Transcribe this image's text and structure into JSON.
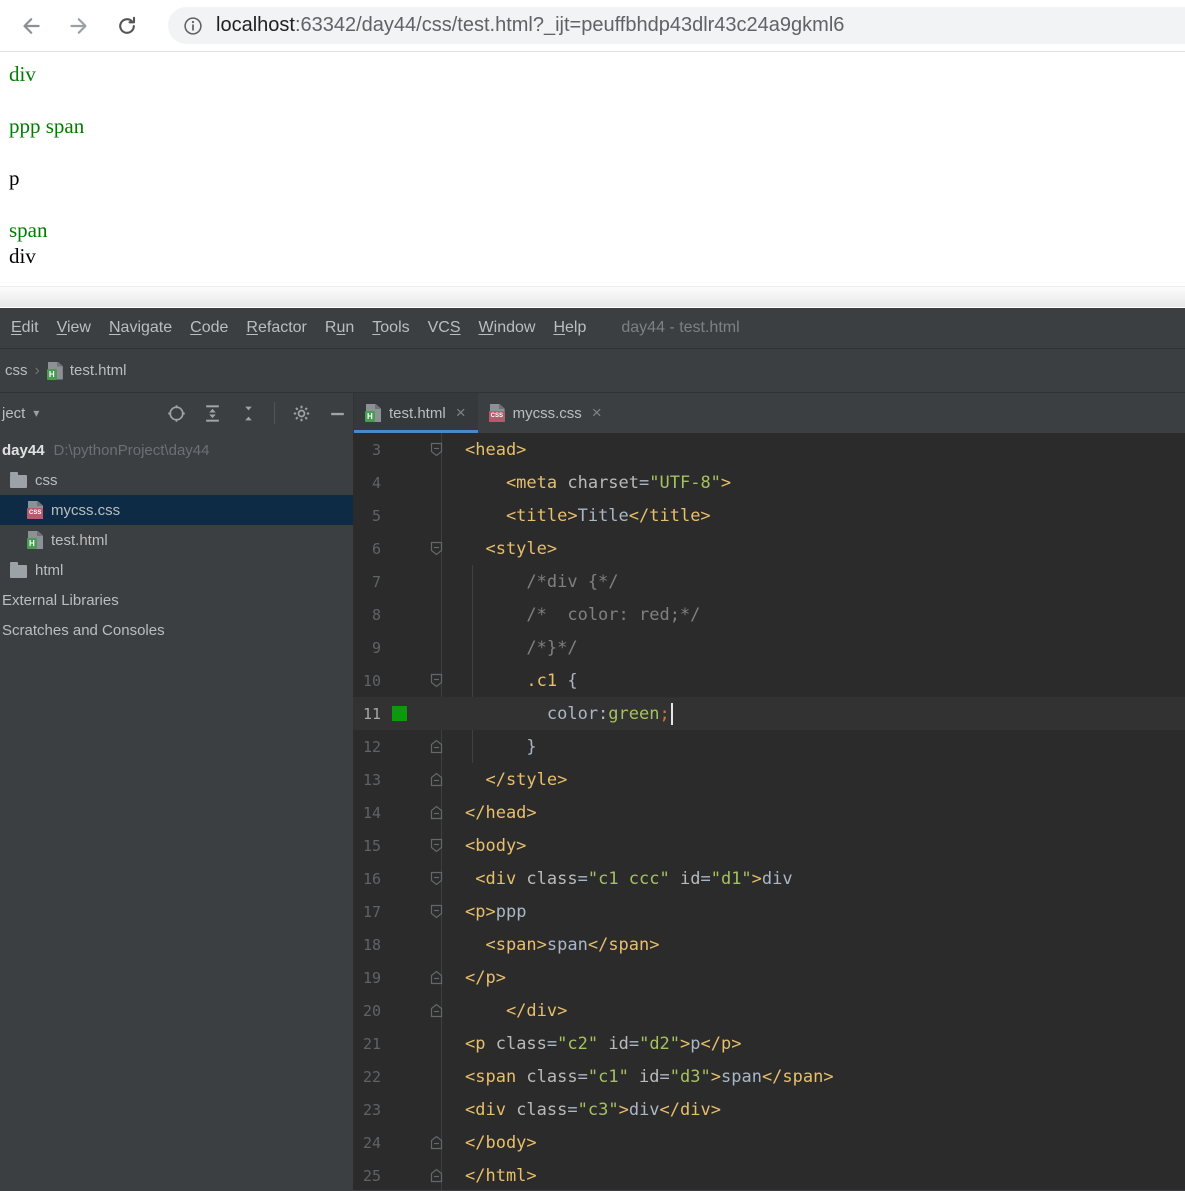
{
  "colors": {
    "content_green": "#007D00",
    "tab_accent_blue": "#4A88C7",
    "gutter_color_preview_green": "#0A9A0A",
    "editor_bg": "#2B2B2B",
    "panel_bg": "#3C3F41",
    "tree_selection_bg": "#0D2B45"
  },
  "browser": {
    "nav_icons": [
      "back-icon",
      "forward-icon",
      "reload-icon"
    ],
    "url": {
      "info_icon": "info-icon",
      "host": "localhost",
      "rest": ":63342/day44/css/test.html?_ijt=peuffbhdp43dlr43c24a9gkml6"
    },
    "content_lines": [
      {
        "text": "div",
        "color": "green",
        "gap_before": false
      },
      {
        "text": "ppp span",
        "color": "green",
        "gap_before": true
      },
      {
        "text": "p",
        "color": "black",
        "gap_before": true
      },
      {
        "text": "span",
        "color": "green",
        "gap_before": true
      },
      {
        "text": "div",
        "color": "black",
        "gap_before": false
      }
    ]
  },
  "menu": {
    "items": [
      {
        "label": "Edit",
        "m": 0
      },
      {
        "label": "View",
        "m": 0
      },
      {
        "label": "Navigate",
        "m": 0
      },
      {
        "label": "Code",
        "m": 0
      },
      {
        "label": "Refactor",
        "m": 0
      },
      {
        "label": "Run",
        "m": 1
      },
      {
        "label": "Tools",
        "m": 0
      },
      {
        "label": "VCS",
        "m": 2
      },
      {
        "label": "Window",
        "m": 0
      },
      {
        "label": "Help",
        "m": 0
      }
    ],
    "window_title": "day44 - test.html"
  },
  "breadcrumb": {
    "folder": "css",
    "separator": "›",
    "file": "test.html"
  },
  "project_panel": {
    "header_label": "ject",
    "chevron": "▾",
    "icons": [
      "locate-icon",
      "expand-all-icon",
      "collapse-all-icon",
      "divider",
      "settings-gear-icon",
      "hide-panel-icon"
    ],
    "tree": [
      {
        "label": "day44",
        "path": "D:\\pythonProject\\day44",
        "icon": "none",
        "indent": 0,
        "bold": true,
        "selected": false
      },
      {
        "label": "css",
        "icon": "folder",
        "indent": 1,
        "selected": false
      },
      {
        "label": "mycss.css",
        "icon": "css",
        "indent": 2,
        "selected": true
      },
      {
        "label": "test.html",
        "icon": "html",
        "indent": 2,
        "selected": false
      },
      {
        "label": "html",
        "icon": "folder",
        "indent": 1,
        "selected": false
      },
      {
        "label": "External Libraries",
        "icon": "none",
        "indent": 0,
        "selected": false
      },
      {
        "label": "Scratches and Consoles",
        "icon": "none",
        "indent": 0,
        "selected": false
      }
    ]
  },
  "tabs": [
    {
      "label": "test.html",
      "type": "html",
      "active": true,
      "close": "×"
    },
    {
      "label": "mycss.css",
      "type": "css",
      "active": false,
      "close": "×"
    }
  ],
  "editor": {
    "lines": [
      {
        "n": 3,
        "fold": "start",
        "tok": [
          [
            "<head>",
            "t"
          ]
        ]
      },
      {
        "n": 4,
        "tok": [
          [
            "    <meta ",
            "t"
          ],
          [
            "charset",
            "a"
          ],
          [
            "=",
            "x"
          ],
          [
            "\"UTF-8\"",
            "v"
          ],
          [
            ">",
            "t"
          ]
        ]
      },
      {
        "n": 5,
        "tok": [
          [
            "    <title>",
            "t"
          ],
          [
            "Title",
            "x"
          ],
          [
            "</title>",
            "t"
          ]
        ]
      },
      {
        "n": 6,
        "fold": "start",
        "tok": [
          [
            "  <style>",
            "t"
          ]
        ]
      },
      {
        "n": 7,
        "tok": [
          [
            "      /*div {*/",
            "c"
          ]
        ]
      },
      {
        "n": 8,
        "tok": [
          [
            "      /*  color: red;*/",
            "c"
          ]
        ]
      },
      {
        "n": 9,
        "tok": [
          [
            "      /*}*/",
            "c"
          ]
        ]
      },
      {
        "n": 10,
        "fold": "start",
        "tok": [
          [
            "      .c1",
            "t"
          ],
          [
            " {",
            "x"
          ]
        ]
      },
      {
        "n": 11,
        "mark": "#0A9A0A",
        "current": true,
        "caret": true,
        "tok": [
          [
            "        color:",
            "x"
          ],
          [
            "green",
            "v"
          ],
          [
            ";",
            "o"
          ]
        ]
      },
      {
        "n": 12,
        "fold": "end",
        "tok": [
          [
            "      }",
            "x"
          ]
        ]
      },
      {
        "n": 13,
        "fold": "end",
        "tok": [
          [
            "  </style>",
            "t"
          ]
        ]
      },
      {
        "n": 14,
        "fold": "end",
        "tok": [
          [
            "</head>",
            "t"
          ]
        ]
      },
      {
        "n": 15,
        "fold": "start",
        "tok": [
          [
            "<body>",
            "t"
          ]
        ]
      },
      {
        "n": 16,
        "fold": "start",
        "tok": [
          [
            " <div ",
            "t"
          ],
          [
            "class",
            "a"
          ],
          [
            "=",
            "x"
          ],
          [
            "\"c1 ccc\"",
            "v"
          ],
          [
            " id",
            "a"
          ],
          [
            "=",
            "x"
          ],
          [
            "\"d1\"",
            "v"
          ],
          [
            ">",
            "t"
          ],
          [
            "div",
            "x"
          ]
        ]
      },
      {
        "n": 17,
        "fold": "start",
        "tok": [
          [
            "<p>",
            "t"
          ],
          [
            "ppp",
            "x"
          ]
        ]
      },
      {
        "n": 18,
        "tok": [
          [
            "  <span>",
            "t"
          ],
          [
            "span",
            "x"
          ],
          [
            "</span>",
            "t"
          ]
        ]
      },
      {
        "n": 19,
        "fold": "end",
        "tok": [
          [
            "</p>",
            "t"
          ]
        ]
      },
      {
        "n": 20,
        "fold": "end",
        "tok": [
          [
            "    </div>",
            "t"
          ]
        ]
      },
      {
        "n": 21,
        "tok": [
          [
            "<p ",
            "t"
          ],
          [
            "class",
            "a"
          ],
          [
            "=",
            "x"
          ],
          [
            "\"c2\"",
            "v"
          ],
          [
            " id",
            "a"
          ],
          [
            "=",
            "x"
          ],
          [
            "\"d2\"",
            "v"
          ],
          [
            ">",
            "t"
          ],
          [
            "p",
            "x"
          ],
          [
            "</p>",
            "t"
          ]
        ]
      },
      {
        "n": 22,
        "tok": [
          [
            "<span ",
            "t"
          ],
          [
            "class",
            "a"
          ],
          [
            "=",
            "x"
          ],
          [
            "\"c1\"",
            "v"
          ],
          [
            " id",
            "a"
          ],
          [
            "=",
            "x"
          ],
          [
            "\"d3\"",
            "v"
          ],
          [
            ">",
            "t"
          ],
          [
            "span",
            "x"
          ],
          [
            "</span>",
            "t"
          ]
        ]
      },
      {
        "n": 23,
        "tok": [
          [
            "<div ",
            "t"
          ],
          [
            "class",
            "a"
          ],
          [
            "=",
            "x"
          ],
          [
            "\"c3\"",
            "v"
          ],
          [
            ">",
            "t"
          ],
          [
            "div",
            "x"
          ],
          [
            "</div>",
            "t"
          ]
        ]
      },
      {
        "n": 24,
        "fold": "end",
        "tok": [
          [
            "</body>",
            "t"
          ]
        ]
      },
      {
        "n": 25,
        "fold": "end",
        "tok": [
          [
            "</html>",
            "t"
          ]
        ]
      }
    ]
  }
}
